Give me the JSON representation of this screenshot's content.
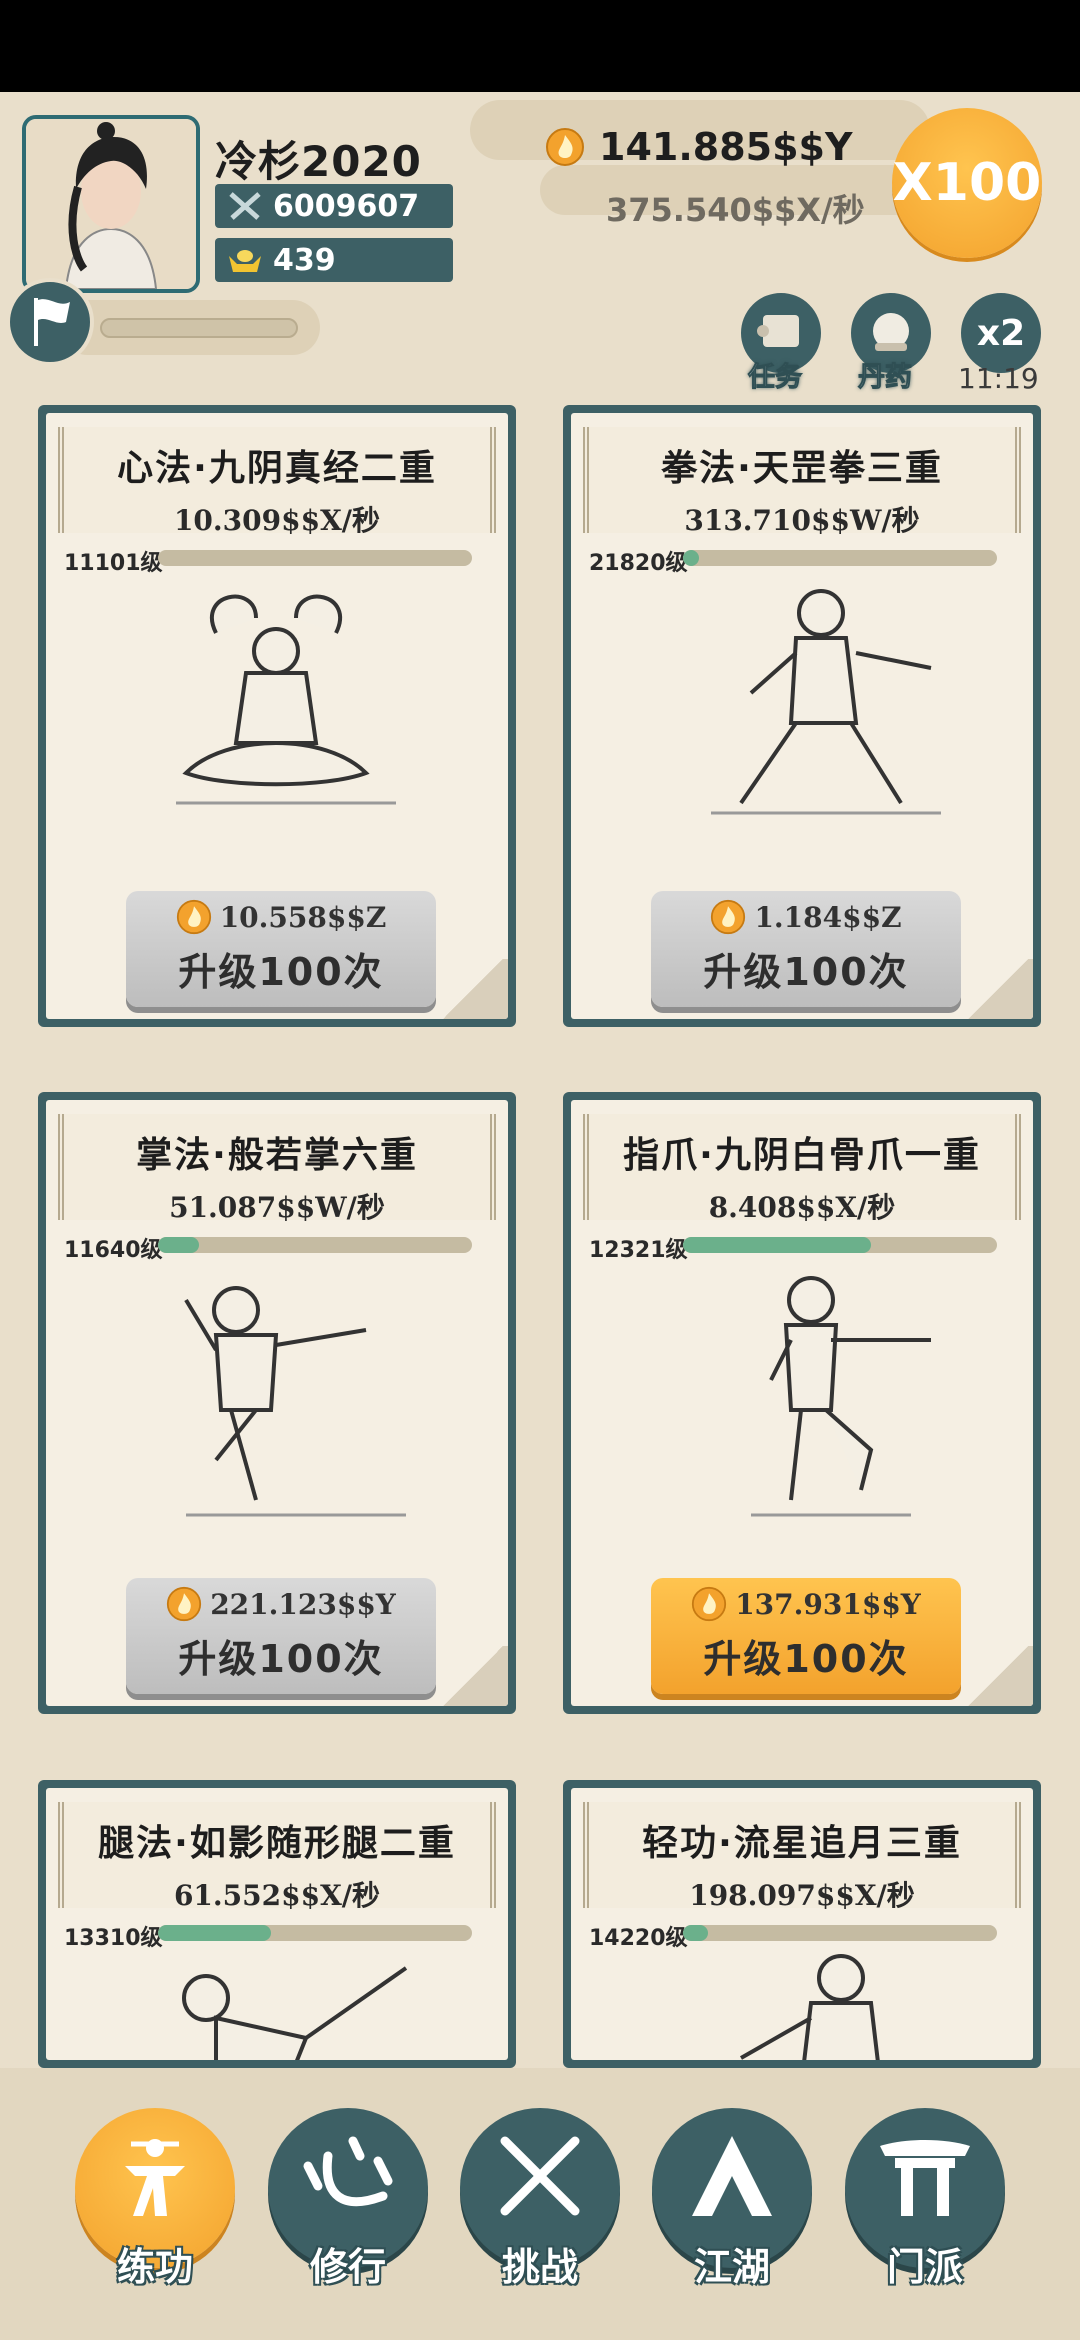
{
  "player": {
    "name": "冷杉2020",
    "power": "6009607",
    "gold": "439"
  },
  "currency": {
    "amount": "141.885$$Y",
    "rate": "375.540$$X/秒"
  },
  "multiplier": "X100",
  "top_actions": [
    {
      "label": "任务",
      "icon": "scroll-icon"
    },
    {
      "label": "丹药",
      "icon": "pill-icon"
    },
    {
      "label": "x2",
      "icon": "double-icon"
    }
  ],
  "timer": "11:19",
  "skills": [
    {
      "title": "心法·九阴真经二重",
      "rate": "10.309$$X/秒",
      "level": "11101级",
      "progress": 0.0,
      "cost": "10.558$$Z",
      "button": "升级100次",
      "affordable": false
    },
    {
      "title": "拳法·天罡拳三重",
      "rate": "313.710$$W/秒",
      "level": "21820级",
      "progress": 0.05,
      "cost": "1.184$$Z",
      "button": "升级100次",
      "affordable": false
    },
    {
      "title": "掌法·般若掌六重",
      "rate": "51.087$$W/秒",
      "level": "11640级",
      "progress": 0.13,
      "cost": "221.123$$Y",
      "button": "升级100次",
      "affordable": false
    },
    {
      "title": "指爪·九阴白骨爪一重",
      "rate": "8.408$$X/秒",
      "level": "12321级",
      "progress": 0.6,
      "cost": "137.931$$Y",
      "button": "升级100次",
      "affordable": true
    },
    {
      "title": "腿法·如影随形腿二重",
      "rate": "61.552$$X/秒",
      "level": "13310级",
      "progress": 0.36,
      "cost": "",
      "button": "",
      "affordable": false
    },
    {
      "title": "轻功·流星追月三重",
      "rate": "198.097$$X/秒",
      "level": "14220级",
      "progress": 0.08,
      "cost": "",
      "button": "",
      "affordable": false
    }
  ],
  "nav": [
    {
      "label": "练功",
      "active": true
    },
    {
      "label": "修行",
      "active": false
    },
    {
      "label": "挑战",
      "active": false
    },
    {
      "label": "江湖",
      "active": false
    },
    {
      "label": "门派",
      "active": false
    }
  ],
  "colors": {
    "accent": "#f3a22d",
    "panel": "#3d6065",
    "paper": "#f5efe3",
    "progress": "#6bb08b"
  }
}
